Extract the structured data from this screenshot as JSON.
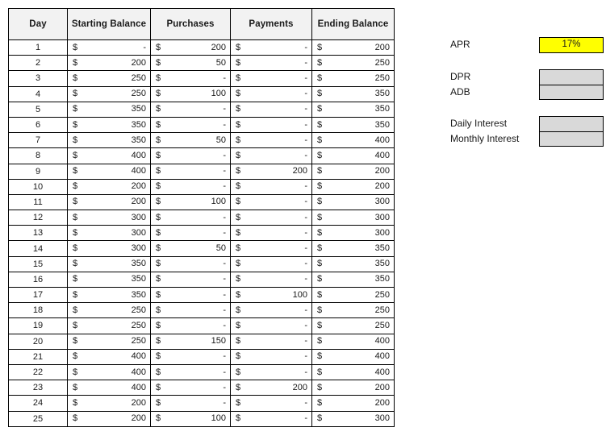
{
  "ledger": {
    "columns": [
      "Day",
      "Starting Balance",
      "Purchases",
      "Payments",
      "Ending Balance"
    ],
    "currency_symbol": "$",
    "zero_display": "-",
    "rows": [
      {
        "day": "1",
        "starting": "-",
        "purchases": "200",
        "payments": "-",
        "ending": "200"
      },
      {
        "day": "2",
        "starting": "200",
        "purchases": "50",
        "payments": "-",
        "ending": "250"
      },
      {
        "day": "3",
        "starting": "250",
        "purchases": "-",
        "payments": "-",
        "ending": "250"
      },
      {
        "day": "4",
        "starting": "250",
        "purchases": "100",
        "payments": "-",
        "ending": "350"
      },
      {
        "day": "5",
        "starting": "350",
        "purchases": "-",
        "payments": "-",
        "ending": "350"
      },
      {
        "day": "6",
        "starting": "350",
        "purchases": "-",
        "payments": "-",
        "ending": "350"
      },
      {
        "day": "7",
        "starting": "350",
        "purchases": "50",
        "payments": "-",
        "ending": "400"
      },
      {
        "day": "8",
        "starting": "400",
        "purchases": "-",
        "payments": "-",
        "ending": "400"
      },
      {
        "day": "9",
        "starting": "400",
        "purchases": "-",
        "payments": "200",
        "ending": "200"
      },
      {
        "day": "10",
        "starting": "200",
        "purchases": "-",
        "payments": "-",
        "ending": "200"
      },
      {
        "day": "11",
        "starting": "200",
        "purchases": "100",
        "payments": "-",
        "ending": "300"
      },
      {
        "day": "12",
        "starting": "300",
        "purchases": "-",
        "payments": "-",
        "ending": "300"
      },
      {
        "day": "13",
        "starting": "300",
        "purchases": "-",
        "payments": "-",
        "ending": "300"
      },
      {
        "day": "14",
        "starting": "300",
        "purchases": "50",
        "payments": "-",
        "ending": "350"
      },
      {
        "day": "15",
        "starting": "350",
        "purchases": "-",
        "payments": "-",
        "ending": "350"
      },
      {
        "day": "16",
        "starting": "350",
        "purchases": "-",
        "payments": "-",
        "ending": "350"
      },
      {
        "day": "17",
        "starting": "350",
        "purchases": "-",
        "payments": "100",
        "ending": "250"
      },
      {
        "day": "18",
        "starting": "250",
        "purchases": "-",
        "payments": "-",
        "ending": "250"
      },
      {
        "day": "19",
        "starting": "250",
        "purchases": "-",
        "payments": "-",
        "ending": "250"
      },
      {
        "day": "20",
        "starting": "250",
        "purchases": "150",
        "payments": "-",
        "ending": "400"
      },
      {
        "day": "21",
        "starting": "400",
        "purchases": "-",
        "payments": "-",
        "ending": "400"
      },
      {
        "day": "22",
        "starting": "400",
        "purchases": "-",
        "payments": "-",
        "ending": "400"
      },
      {
        "day": "23",
        "starting": "400",
        "purchases": "-",
        "payments": "200",
        "ending": "200"
      },
      {
        "day": "24",
        "starting": "200",
        "purchases": "-",
        "payments": "-",
        "ending": "200"
      },
      {
        "day": "25",
        "starting": "200",
        "purchases": "100",
        "payments": "-",
        "ending": "300"
      }
    ]
  },
  "summary": {
    "apr": {
      "label": "APR",
      "value": "17%"
    },
    "dpr": {
      "label": "DPR",
      "value": ""
    },
    "adb": {
      "label": "ADB",
      "value": ""
    },
    "daily_interest": {
      "label": "Daily Interest",
      "value": ""
    },
    "monthly_interest": {
      "label": "Monthly Interest",
      "value": ""
    }
  },
  "colors": {
    "highlight": "#ffff00",
    "input_box": "#d9d9d9",
    "header_fill": "#f2f2f2",
    "border": "#000000"
  }
}
